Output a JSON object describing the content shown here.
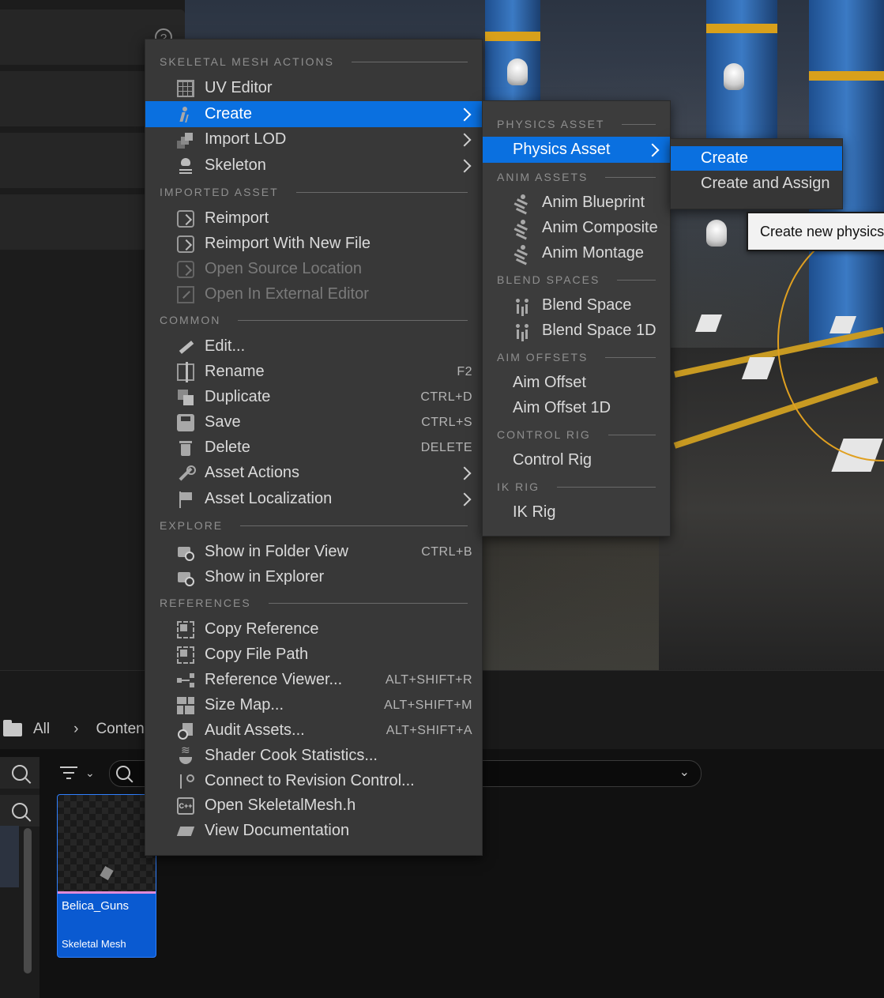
{
  "background": {
    "breadcrumb": {
      "root": "All",
      "separator": "›",
      "current": "Content"
    },
    "asset": {
      "name": "Belica_Guns",
      "type": "Skeletal Mesh"
    },
    "help_glyph": "?"
  },
  "main_menu": {
    "sections": {
      "skeletal": "SKELETAL MESH ACTIONS",
      "imported": "IMPORTED ASSET",
      "common": "COMMON",
      "explore": "EXPLORE",
      "references": "REFERENCES"
    },
    "items": {
      "uv_editor": "UV Editor",
      "create": "Create",
      "import_lod": "Import LOD",
      "skeleton": "Skeleton",
      "reimport": "Reimport",
      "reimport_new": "Reimport With New File",
      "open_source": "Open Source Location",
      "open_external": "Open In External Editor",
      "edit": "Edit...",
      "rename": "Rename",
      "duplicate": "Duplicate",
      "save": "Save",
      "delete": "Delete",
      "asset_actions": "Asset Actions",
      "asset_localization": "Asset Localization",
      "show_folder": "Show in Folder View",
      "show_explorer": "Show in Explorer",
      "copy_reference": "Copy Reference",
      "copy_file_path": "Copy File Path",
      "reference_viewer": "Reference Viewer...",
      "size_map": "Size Map...",
      "audit_assets": "Audit Assets...",
      "shader_cook": "Shader Cook Statistics...",
      "connect_revision": "Connect to Revision Control...",
      "open_header": "Open SkeletalMesh.h",
      "view_docs": "View Documentation"
    },
    "shortcuts": {
      "rename": "F2",
      "duplicate": "CTRL+D",
      "save": "CTRL+S",
      "delete": "DELETE",
      "show_folder": "CTRL+B",
      "reference_viewer": "ALT+SHIFT+R",
      "size_map": "ALT+SHIFT+M",
      "audit_assets": "ALT+SHIFT+A"
    }
  },
  "create_submenu": {
    "sections": {
      "physics": "PHYSICS ASSET",
      "anim": "ANIM ASSETS",
      "blend": "BLEND SPACES",
      "aim": "AIM OFFSETS",
      "control": "CONTROL RIG",
      "ik": "IK RIG"
    },
    "items": {
      "physics_asset": "Physics Asset",
      "anim_blueprint": "Anim Blueprint",
      "anim_composite": "Anim Composite",
      "anim_montage": "Anim Montage",
      "blend_space": "Blend Space",
      "blend_space_1d": "Blend Space 1D",
      "aim_offset": "Aim Offset",
      "aim_offset_1d": "Aim Offset 1D",
      "control_rig": "Control Rig",
      "ik_rig": "IK Rig"
    }
  },
  "physics_submenu": {
    "create": "Create",
    "create_assign": "Create and Assign"
  },
  "tooltip": {
    "text": "Create new physics"
  },
  "colors": {
    "selection": "#0a70e0",
    "menu_bg": "#383838"
  }
}
